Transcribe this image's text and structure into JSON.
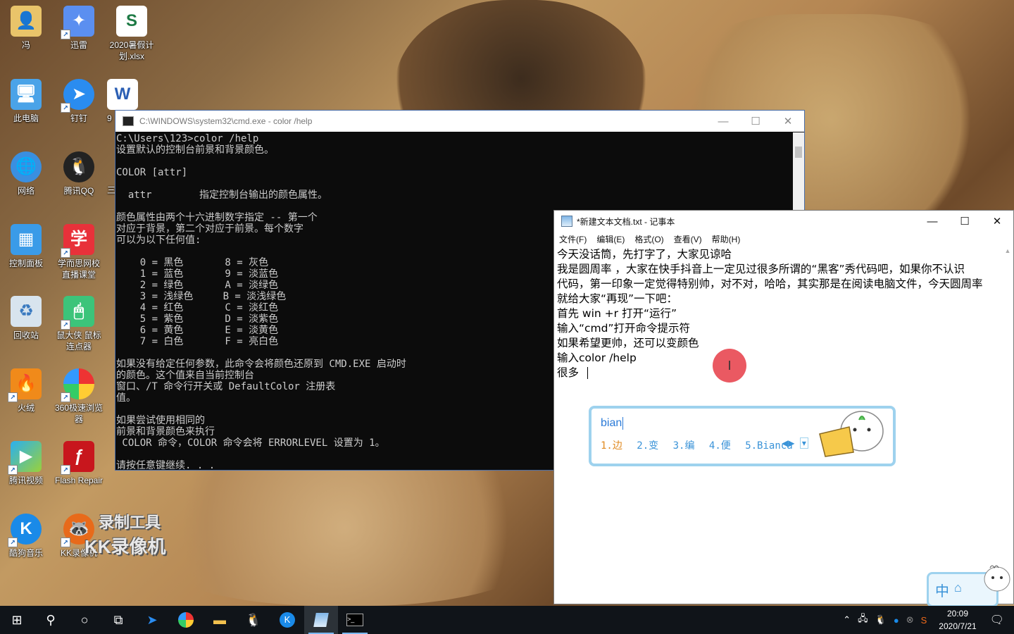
{
  "desktop": {
    "icons": [
      {
        "label": "冯",
        "icon": "user-folder-icon"
      },
      {
        "label": "迅雷",
        "icon": "xunlei-icon"
      },
      {
        "label": "2020暑假计划.xlsx",
        "icon": "excel-file-icon"
      },
      {
        "label": "此电脑",
        "icon": "computer-icon"
      },
      {
        "label": "钉钉",
        "icon": "dingtalk-icon"
      },
      {
        "label": "9",
        "icon": "word-file-icon"
      },
      {
        "label": "网络",
        "icon": "network-icon"
      },
      {
        "label": "腾讯QQ",
        "icon": "qq-icon"
      },
      {
        "label": "三",
        "icon": "unknown-icon"
      },
      {
        "label": "控制面板",
        "icon": "control-panel-icon"
      },
      {
        "label": "学而思网校直播课堂",
        "icon": "xueersi-icon"
      },
      {
        "label": "回收站",
        "icon": "recycle-bin-icon"
      },
      {
        "label": "鼠大侠 鼠标连点器",
        "icon": "mouse-clicker-icon"
      },
      {
        "label": "火绒",
        "icon": "huorong-icon"
      },
      {
        "label": "360极速浏览器",
        "icon": "360-browser-icon"
      },
      {
        "label": "腾讯视频",
        "icon": "tencent-video-icon"
      },
      {
        "label": "Flash Repair",
        "icon": "flash-repair-icon"
      },
      {
        "label": "酷狗音乐",
        "icon": "kugou-icon"
      },
      {
        "label": "KK录像机",
        "icon": "kk-recorder-icon"
      }
    ],
    "watermark": {
      "line1": "录制工具",
      "line2": "KK录像机"
    }
  },
  "cmd": {
    "title": "C:\\WINDOWS\\system32\\cmd.exe - color  /help",
    "lines": [
      "C:\\Users\\123>color /help",
      "设置默认的控制台前景和背景颜色。",
      "",
      "COLOR [attr]",
      "",
      "  attr        指定控制台输出的颜色属性。",
      "",
      "颜色属性由两个十六进制数字指定 -- 第一个",
      "对应于背景，第二个对应于前景。每个数字",
      "可以为以下任何值:",
      "",
      "    0 = 黑色       8 = 灰色",
      "    1 = 蓝色       9 = 淡蓝色",
      "    2 = 绿色       A = 淡绿色",
      "    3 = 浅绿色     B = 淡浅绿色",
      "    4 = 红色       C = 淡红色",
      "    5 = 紫色       D = 淡紫色",
      "    6 = 黄色       E = 淡黄色",
      "    7 = 白色       F = 亮白色",
      "",
      "如果没有给定任何参数，此命令会将颜色还原到 CMD.EXE 启动时",
      "的颜色。这个值来自当前控制台",
      "窗口、/T 命令行开关或 DefaultColor 注册表",
      "值。",
      "",
      "如果尝试使用相同的",
      "前景和背景颜色来执行",
      " COLOR 命令，COLOR 命令会将 ERRORLEVEL 设置为 1。",
      "",
      "请按任意键继续. . ."
    ]
  },
  "notepad": {
    "title": "*新建文本文档.txt - 记事本",
    "menu": [
      "文件(F)",
      "编辑(E)",
      "格式(O)",
      "查看(V)",
      "帮助(H)"
    ],
    "lines": [
      "今天没话筒，先打字了，大家见谅哈",
      "我是圆周率 ，大家在快手抖音上一定见过很多所谓的“黑客”秀代码吧，如果你不认识",
      "代码，第一印象一定觉得特别帅，对不对，哈哈，其实那是在阅读电脑文件，今天圆周率",
      "就给大家“再现”一下吧：",
      "首先  win +r 打开“运行”",
      "输入“cmd”打开命令提示符",
      "如果希望更帅，还可以变颜色",
      "输入color /help",
      "很多"
    ]
  },
  "ime": {
    "typed": "bian",
    "candidates": [
      "1.边",
      "2.变",
      "3.编",
      "4.便",
      "5.Bianca"
    ],
    "status_zh": "中",
    "status_opt": "⌂"
  },
  "taskbar": {
    "time": "20:09",
    "date": "2020/7/21"
  }
}
